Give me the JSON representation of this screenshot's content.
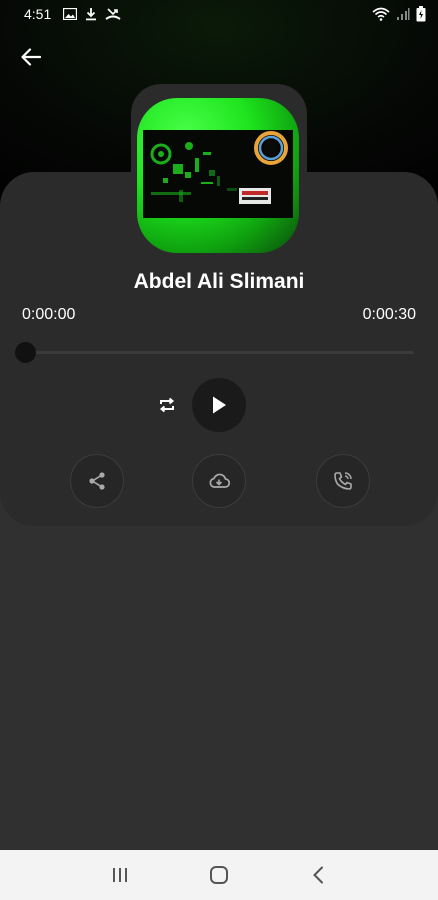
{
  "status_bar": {
    "time": "4:51",
    "left_icons": [
      "image-icon",
      "download-icon",
      "missed-call-icon"
    ],
    "right_icons": [
      "wifi-icon",
      "signal-icon",
      "battery-icon"
    ]
  },
  "header": {
    "back_icon": "arrow-left-icon"
  },
  "player": {
    "title": "Abdel Ali Slimani",
    "time_current": "0:00:00",
    "time_total": "0:00:30",
    "progress": 0.0,
    "controls": {
      "repeat_icon": "repeat-icon",
      "play_icon": "play-icon"
    },
    "actions": [
      {
        "name": "share",
        "icon": "share-icon"
      },
      {
        "name": "download",
        "icon": "cloud-download-icon"
      },
      {
        "name": "set-ringtone",
        "icon": "phone-ring-icon"
      }
    ]
  },
  "colors": {
    "background": "#303030",
    "card": "#2b2b2b",
    "artwork_green": "#1ee41e",
    "play_button": "#1a1a1a",
    "nav_bar": "#f3f3f3"
  },
  "nav_bar": {
    "buttons": [
      "recent-apps-icon",
      "home-icon",
      "back-icon"
    ]
  }
}
